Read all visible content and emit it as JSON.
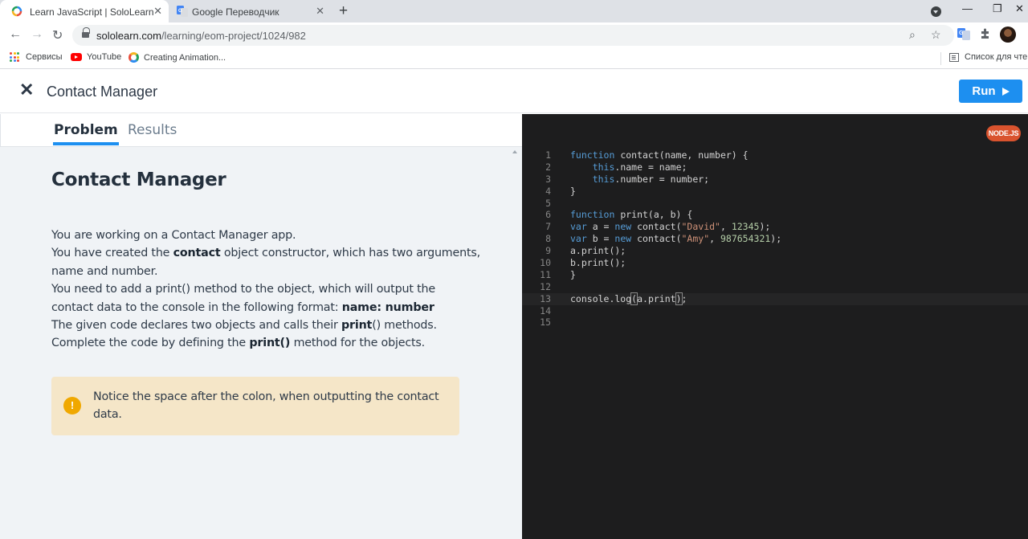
{
  "browser": {
    "tabs": [
      {
        "title": "Learn JavaScript | SoloLearn",
        "active": true,
        "icon": "sololearn-icon"
      },
      {
        "title": "Google Переводчик",
        "active": false,
        "icon": "google-translate-icon"
      }
    ],
    "url_host": "sololearn.com",
    "url_path": "/learning/eom-project/1024/982",
    "bookmarks": [
      {
        "label": "Сервисы",
        "icon": "apps-grid-icon"
      },
      {
        "label": "YouTube",
        "icon": "youtube-icon"
      },
      {
        "label": "Creating Animation..."
      }
    ],
    "reading_list": "Список для чтени"
  },
  "app": {
    "title": "Contact Manager",
    "run_label": "Run",
    "accent_color": "#1d8ff0"
  },
  "problem": {
    "tabs": [
      "Problem",
      "Results"
    ],
    "active_tab": "Problem",
    "heading": "Contact Manager",
    "paragraph": [
      [
        {
          "t": "You are working on a Contact Manager app."
        }
      ],
      [
        {
          "t": "You have created the "
        },
        {
          "t": "contact",
          "b": true
        },
        {
          "t": " object constructor, which has two arguments,"
        }
      ],
      [
        {
          "t": "name and number."
        }
      ],
      [
        {
          "t": "You need to add a print() method to the object, which will output the"
        }
      ],
      [
        {
          "t": "contact data to the console in the following format: "
        },
        {
          "t": "name: number",
          "b": true
        }
      ],
      [
        {
          "t": "The given code declares two objects and calls their "
        },
        {
          "t": "print",
          "b": true
        },
        {
          "t": "() methods."
        }
      ],
      [
        {
          "t": "Complete the code by defining the "
        },
        {
          "t": "print()",
          "b": true
        },
        {
          "t": " method for the objects."
        }
      ]
    ],
    "notice": "Notice the space after the colon, when outputting the contact data.",
    "notice_icon": "!"
  },
  "editor": {
    "runtime_badge": "NODE.JS",
    "current_line": 13,
    "lines": [
      [
        {
          "k": "kw",
          "t": "function"
        },
        {
          "t": " contact(name, number) {"
        }
      ],
      [
        {
          "t": "    "
        },
        {
          "k": "kw",
          "t": "this"
        },
        {
          "t": ".name = name;"
        }
      ],
      [
        {
          "t": "    "
        },
        {
          "k": "kw",
          "t": "this"
        },
        {
          "t": ".number = number;"
        }
      ],
      [
        {
          "t": "}"
        }
      ],
      [],
      [
        {
          "k": "kw",
          "t": "function"
        },
        {
          "t": " print(a, b) {"
        }
      ],
      [
        {
          "k": "kw",
          "t": "var"
        },
        {
          "t": " a = "
        },
        {
          "k": "kw",
          "t": "new"
        },
        {
          "t": " contact("
        },
        {
          "k": "str",
          "t": "\"David\""
        },
        {
          "t": ", "
        },
        {
          "k": "num",
          "t": "12345"
        },
        {
          "t": ");"
        }
      ],
      [
        {
          "k": "kw",
          "t": "var"
        },
        {
          "t": " b = "
        },
        {
          "k": "kw",
          "t": "new"
        },
        {
          "t": " contact("
        },
        {
          "k": "str",
          "t": "\"Amy\""
        },
        {
          "t": ", "
        },
        {
          "k": "num",
          "t": "987654321"
        },
        {
          "t": ");"
        }
      ],
      [
        {
          "t": "a.print();"
        }
      ],
      [
        {
          "t": "b.print();"
        }
      ],
      [
        {
          "t": "}"
        }
      ],
      [],
      [
        {
          "t": "console.log"
        },
        {
          "k": "bracket-box",
          "t": "("
        },
        {
          "t": "a.print"
        },
        {
          "k": "bracket-box",
          "t": ")"
        },
        {
          "t": ";"
        }
      ],
      [],
      []
    ]
  }
}
